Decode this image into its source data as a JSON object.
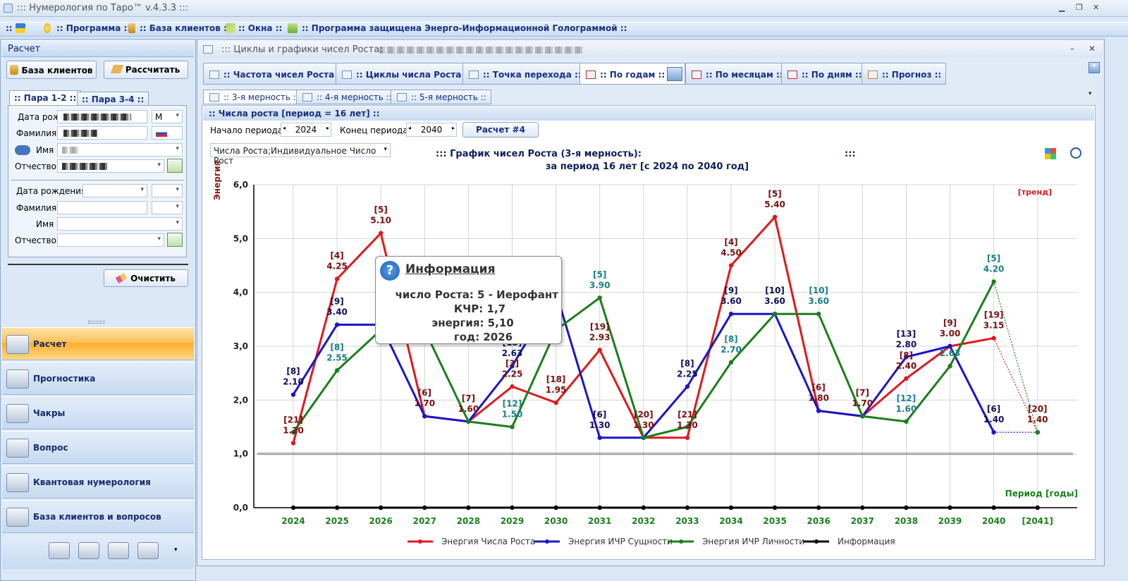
{
  "window": {
    "title": "::: Нумерология по Таро™ v.4.3.3 :::"
  },
  "menu": {
    "items": [
      ":: Программа ::",
      ":: База клиентов ::",
      "::  Окна  ::",
      ":: Программа защищена Энерго-Информационной Голограммой ::"
    ],
    "prefix": "::"
  },
  "left": {
    "header": "Расчет",
    "btn_clients": "База клиентов",
    "btn_calc": "Рассчитать",
    "tabs": [
      "Пара 1-2 ::",
      ":: Пара 3-4 ::"
    ],
    "tab_prefix": "::",
    "form1": {
      "dob": "Дата рожд",
      "gender": "М",
      "surname": "Фамилия",
      "name": "Имя",
      "patronymic": "Отчество"
    },
    "form2": {
      "dob": "Дата рождения",
      "surname": "Фамилия",
      "name": "Имя",
      "patronymic": "Отчество"
    },
    "btn_clear": "Очистить",
    "nav": [
      "Расчет",
      "Прогностика",
      "Чакры",
      "Вопрос",
      "Квантовая нумерология",
      "База клиентов и вопросов"
    ]
  },
  "doc": {
    "title": "::: Циклы и графики чисел Роста:",
    "tabs": [
      ":: Частота чисел Роста ::",
      ":: Циклы числа Роста ::",
      ":: Точка перехода ::",
      ":: По годам ::",
      ":: По месяцам ::",
      ":: По дням ::",
      ":: Прогноз ::"
    ],
    "subtabs": [
      ":: 3-я мерность ::",
      ":: 4-я мерность ::",
      ":: 5-я мерность ::"
    ],
    "panel_title": ":: Числа роста [период = 16 лет] ::",
    "start_label": "Начало периода:",
    "start_value": "2024",
    "end_label": "Конец периода:",
    "end_value": "2040",
    "calc_button": "Расчет #4",
    "series_select": "Числа Роста;Индивидуальное Число Рост"
  },
  "tooltip": {
    "title": "Информация",
    "line1": "число Роста: 5 - Иерофант",
    "line2": "КЧР: 1,7",
    "line3": "энергия: 5,10",
    "line4": "год: 2026"
  },
  "colors": {
    "red": "#e0191e",
    "blue": "#1b16c8",
    "green": "#1b7f1b",
    "black": "#000000",
    "accent": "#ffb02e"
  },
  "chart_data": {
    "type": "line",
    "title": "::: График чисел Роста (3-я мерность):",
    "title_suffix": ":::",
    "subtitle": "за период 16 лет [с 2024 по 2040 год]",
    "ylabel": "Энергия",
    "xlabel": "Период [годы]",
    "trend_label": "[тренд]",
    "ylim": [
      0,
      6
    ],
    "yticks": [
      "0,0",
      "1,0",
      "2,0",
      "3,0",
      "4,0",
      "5,0",
      "6,0"
    ],
    "categories": [
      "2024",
      "2025",
      "2026",
      "2027",
      "2028",
      "2029",
      "2030",
      "2031",
      "2032",
      "2033",
      "2034",
      "2035",
      "2036",
      "2037",
      "2038",
      "2039",
      "2040",
      "[2041]"
    ],
    "baseline": 1.0,
    "series": [
      {
        "name": "Энергия Числа Роста",
        "color": "#e0191e",
        "label_color": "#7a0f0f",
        "values": [
          1.2,
          4.25,
          5.1,
          1.7,
          1.6,
          2.25,
          1.95,
          2.93,
          1.3,
          1.3,
          4.5,
          5.4,
          1.8,
          1.7,
          2.4,
          3.0,
          3.15,
          1.4
        ],
        "tags": [
          "[21]",
          "[4]",
          "[5]",
          "[6]",
          "[7]",
          "[3]",
          "[18]",
          "[19]",
          "[20]",
          "[21]",
          "[4]",
          "[5]",
          "[6]",
          "[7]",
          "[8]",
          "[9]",
          "[19]",
          "[20]"
        ],
        "labels": [
          "1.20",
          "4.25",
          "5.10",
          "1.70",
          "1.60",
          "2.25",
          "1.95",
          "2.93",
          "1.30",
          "1.30",
          "4.50",
          "5.40",
          "1.80",
          "1.70",
          "2.40",
          "3.00",
          "3.15",
          "1.40"
        ]
      },
      {
        "name": "Энергия ИЧР Сущности",
        "color": "#1b16c8",
        "label_color": "#10105a",
        "values": [
          2.1,
          3.4,
          3.4,
          1.7,
          1.6,
          2.63,
          4.0,
          1.3,
          1.3,
          2.25,
          3.6,
          3.6,
          1.8,
          1.7,
          2.8,
          3.0,
          1.4,
          1.4
        ],
        "tags": [
          "[8]",
          "[9]",
          "",
          "",
          "",
          "[13]",
          "",
          "[6]",
          "",
          "[8]",
          "[9]",
          "[10]",
          "",
          "",
          "[13]",
          "",
          "[6]",
          ""
        ],
        "labels": [
          "2.10",
          "3.40",
          "",
          "",
          "",
          "2.63",
          "",
          "1.30",
          "",
          "2.25",
          "3.60",
          "3.60",
          "",
          "",
          "2.80",
          "",
          "1.40",
          ""
        ]
      },
      {
        "name": "Энергия ИЧР Личности",
        "color": "#1b7f1b",
        "label_color": "#1a7f8a",
        "values": [
          1.4,
          2.55,
          3.3,
          3.3,
          1.6,
          1.5,
          3.3,
          3.9,
          1.3,
          1.5,
          2.7,
          3.6,
          3.6,
          1.7,
          1.6,
          2.63,
          4.2,
          1.4
        ],
        "tags": [
          "",
          "[8]",
          "",
          "",
          "",
          "[12]",
          "",
          "[5]",
          "",
          "",
          "[8]",
          "",
          "[10]",
          "",
          "[12]",
          "",
          "[5]",
          ""
        ],
        "labels": [
          "",
          "2.55",
          "",
          "",
          "",
          "1.50",
          "",
          "3.90",
          "",
          "",
          "2.70",
          "",
          "3.60",
          "",
          "1.60",
          "2.63",
          "4.20",
          ""
        ]
      },
      {
        "name": "Информация",
        "color": "#000000",
        "label_color": "#000000",
        "values": [
          0,
          0,
          0,
          0,
          0,
          0,
          0,
          0,
          0,
          0,
          0,
          0,
          0,
          0,
          0,
          0,
          0,
          0
        ]
      }
    ]
  }
}
